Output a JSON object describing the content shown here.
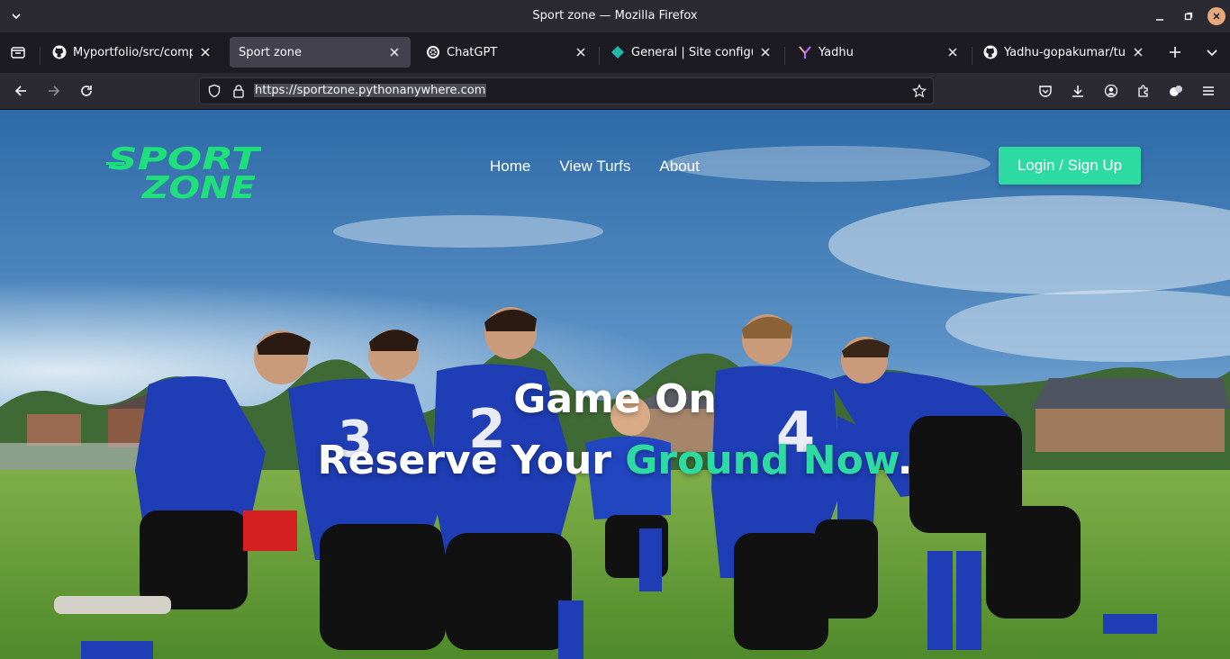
{
  "window": {
    "title": "Sport zone — Mozilla Firefox"
  },
  "tabs": [
    {
      "label": "Myportfolio/src/compor",
      "icon": "github-icon"
    },
    {
      "label": "Sport zone",
      "icon": "none",
      "active": true
    },
    {
      "label": "ChatGPT",
      "icon": "chatgpt-icon"
    },
    {
      "label": "General | Site configurat",
      "icon": "diamond-icon"
    },
    {
      "label": "Yadhu",
      "icon": "y-icon"
    },
    {
      "label": "Yadhu-gopakumar/turf",
      "icon": "github-icon"
    }
  ],
  "navbar": {
    "url": "https://sportzone.pythonanywhere.com"
  },
  "site": {
    "logo_line1": "SPORT",
    "logo_line2": "ZONE",
    "nav": [
      "Home",
      "View Turfs",
      "About"
    ],
    "login_label": "Login / Sign Up",
    "hero_line1": "Game On",
    "hero_line2_part1": "Reserve Your ",
    "hero_line2_accent": "Ground Now",
    "hero_line2_end": ".",
    "accent_color": "#2ddba2"
  }
}
